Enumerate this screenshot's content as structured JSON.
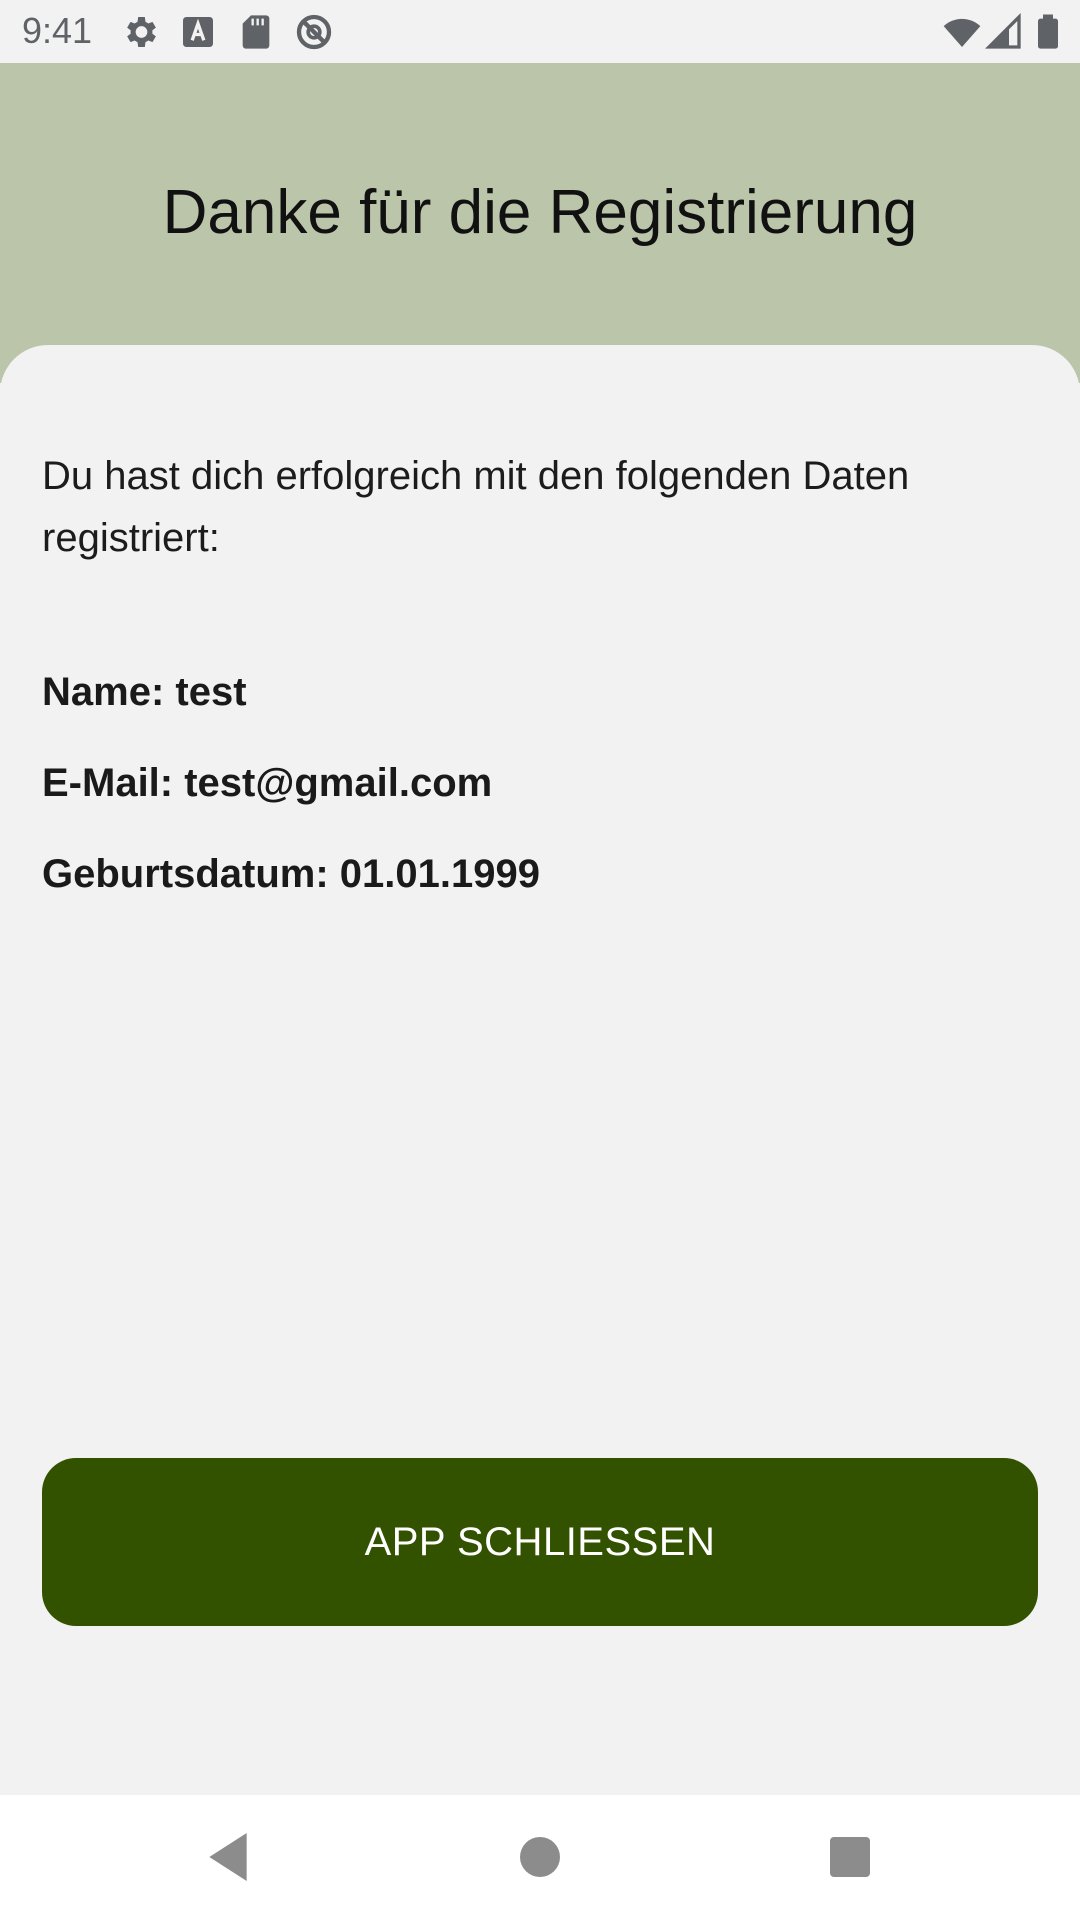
{
  "status_bar": {
    "time": "9:41",
    "left_icons": [
      "gear-icon",
      "a-badge-icon",
      "sd-card-icon",
      "no-sync-icon"
    ],
    "right_icons": [
      "wifi-icon",
      "signal-icon",
      "battery-icon"
    ]
  },
  "header": {
    "title": "Danke für die Registrierung",
    "background_color": "#bac5a9"
  },
  "content": {
    "intro": "Du hast dich erfolgreich mit den folgenden Daten registriert:",
    "name_line": "Name: test",
    "email_line": "E-Mail: test@gmail.com",
    "birthdate_line": "Geburtsdatum: 01.01.1999"
  },
  "actions": {
    "close_label": "APP SCHLIESSEN",
    "button_color": "#335200"
  },
  "nav_bar": {
    "icons": [
      "back-icon",
      "home-icon",
      "recents-icon"
    ]
  }
}
